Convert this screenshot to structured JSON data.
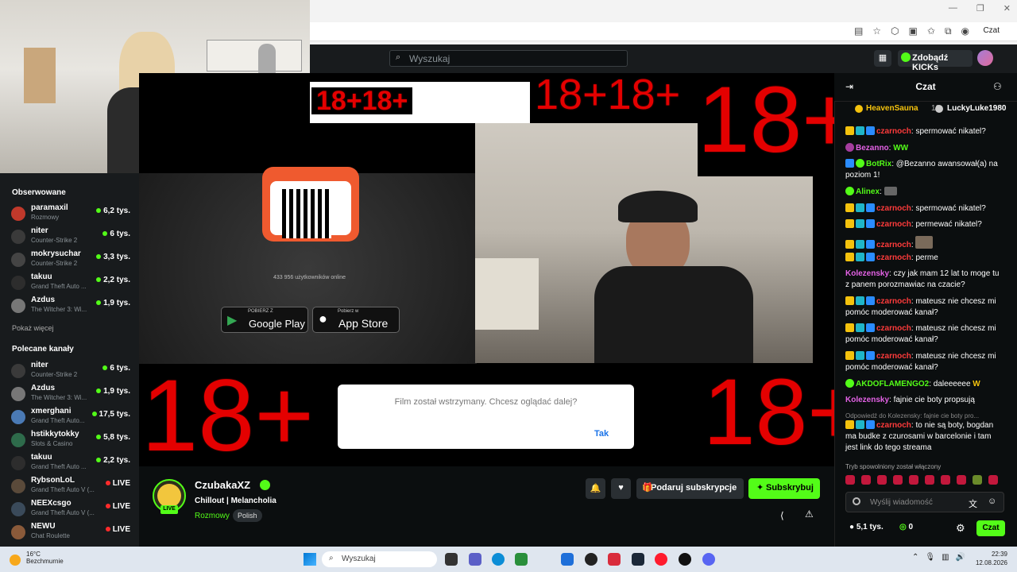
{
  "browser": {
    "tab_chat_label": "Czat"
  },
  "header": {
    "search_placeholder": "Wyszukaj",
    "kicks_label": "Zdobądź KICKs"
  },
  "sidebar": {
    "followed_title": "Obserwowane",
    "followed": [
      {
        "name": "paramaxil",
        "game": "Rozmowy",
        "viewers": "6,2 tys.",
        "color": "#c0392b"
      },
      {
        "name": "niter",
        "game": "Counter-Strike 2",
        "viewers": "6 tys.",
        "color": "#3a3a3a"
      },
      {
        "name": "mokrysuchar",
        "game": "Counter-Strike 2",
        "viewers": "3,3 tys.",
        "color": "#444"
      },
      {
        "name": "takuu",
        "game": "Grand Theft Auto ...",
        "viewers": "2,2 tys.",
        "color": "#2d2d2d"
      },
      {
        "name": "Azdus",
        "game": "The Witcher 3: Wi...",
        "viewers": "1,9 tys.",
        "color": "#777"
      }
    ],
    "show_more": "Pokaż więcej",
    "recommended_title": "Polecane kanały",
    "recommended": [
      {
        "name": "niter",
        "game": "Counter-Strike 2",
        "viewers": "6 tys.",
        "color": "#3a3a3a"
      },
      {
        "name": "Azdus",
        "game": "The Witcher 3: Wi...",
        "viewers": "1,9 tys.",
        "color": "#777"
      },
      {
        "name": "xmerghani",
        "game": "Grand Theft Auto...",
        "viewers": "17,5 tys.",
        "color": "#4a7ab5"
      },
      {
        "name": "hstikkytokky",
        "game": "Slots & Casino",
        "viewers": "5,8 tys.",
        "color": "#2e6b4b"
      },
      {
        "name": "takuu",
        "game": "Grand Theft Auto ...",
        "viewers": "2,2 tys.",
        "color": "#2d2d2d"
      },
      {
        "name": "RybsonLoL",
        "game": "Grand Theft Auto V (...",
        "viewers": "LIVE",
        "color": "#5a4a3a"
      },
      {
        "name": "NEEXcsgo",
        "game": "Grand Theft Auto V (...",
        "viewers": "LIVE",
        "color": "#3a4a5a"
      },
      {
        "name": "NEWU",
        "game": "Chat Roulette",
        "viewers": "LIVE",
        "color": "#8a5a3a"
      }
    ]
  },
  "player": {
    "tag": "18+",
    "tag_double": "18+18+",
    "users_online": "433 956 użytkowników online",
    "gplay_small": "POBIERZ Z",
    "gplay": "Google Play",
    "appstore_small": "Pobierz w",
    "appstore": "App Store",
    "dialog_text": "Film został wstrzymany. Chcesz oglądać dalej?",
    "dialog_ok": "Tak"
  },
  "stream": {
    "name": "CzubakaXZ",
    "title": "Chillout | Melancholia",
    "category": "Rozmowy",
    "language": "Polish",
    "live": "LIVE",
    "gift_label": "Podaruj subskrypcje",
    "subscribe_label": "Subskrybuj"
  },
  "chat": {
    "title": "Czat",
    "pinned_user1": "HeavenSauna",
    "pinned_count1": "10",
    "pinned_user2": "LuckyLuke1980",
    "messages": [
      {
        "user": "czarnoch",
        "text": "spermować nikatel?",
        "color": "#ff3b3b"
      },
      {
        "user": "Bezanno",
        "text": "WW",
        "color": "#e462e6"
      },
      {
        "user": "BotRix",
        "text": "@Bezanno awansował(a) na poziom 1!",
        "color": "#53fc18"
      },
      {
        "user": "Alinex",
        "text": "",
        "color": "#53fc18"
      },
      {
        "user": "czarnoch",
        "text": "spermować nikatel?",
        "color": "#ff3b3b"
      },
      {
        "user": "czarnoch",
        "text": "permewać nikatel?",
        "color": "#ff3b3b"
      },
      {
        "user": "czarnoch",
        "text": "",
        "color": "#ff3b3b"
      },
      {
        "user": "czarnoch",
        "text": "perme",
        "color": "#ff3b3b"
      },
      {
        "user": "Kolezensky",
        "text": "czy jak mam 12 lat to moge tu z panem porozmawiac na czacie?",
        "color": "#e462e6"
      },
      {
        "user": "czarnoch",
        "text": "mateusz nie chcesz mi pomóc moderować kanał?",
        "color": "#ff3b3b"
      },
      {
        "user": "czarnoch",
        "text": "mateusz nie chcesz mi pomóc moderować kanał?",
        "color": "#ff3b3b"
      },
      {
        "user": "czarnoch",
        "text": "mateusz nie chcesz mi pomóc moderować kanał?",
        "color": "#ff3b3b"
      },
      {
        "user": "AKDOFLAMENGO2",
        "text": "daleeeeee",
        "color": "#53fc18"
      },
      {
        "user": "Kolezensky",
        "text": "fajnie cie boty propsują",
        "color": "#e462e6"
      },
      {
        "user": "czarnoch",
        "text": "to nie są boty, bogdan ma budke z czurosami w barcelonie i tam jest link do tego streama",
        "color": "#ff3b3b"
      }
    ],
    "reply_to": "Odpowiedź do Kolezensky: fajnie cie boty pro...",
    "slowmode": "Tryb spowolniony został włączony",
    "input_placeholder": "Wyślij wiadomość",
    "viewers": "5,1 tys.",
    "points": "0",
    "send_label": "Czat"
  },
  "taskbar": {
    "temp": "16°C",
    "weather": "Bezchmurnie",
    "search": "Wyszukaj",
    "time": "22:39",
    "date": "12.08.2026"
  },
  "colors": {
    "accent": "#53fc18",
    "warning_red": "#e40000"
  }
}
